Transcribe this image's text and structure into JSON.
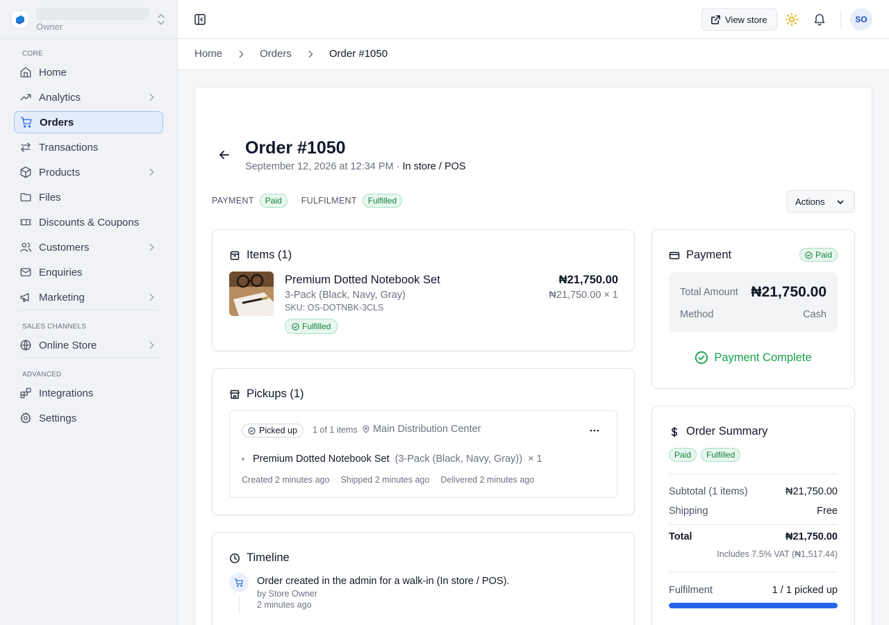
{
  "store": {
    "role": "Owner"
  },
  "nav": {
    "sections": {
      "core": "CORE",
      "sales": "SALES CHANNELS",
      "advanced": "ADVANCED"
    },
    "items": {
      "home": "Home",
      "analytics": "Analytics",
      "orders": "Orders",
      "transactions": "Transactions",
      "products": "Products",
      "files": "Files",
      "discounts": "Discounts & Coupons",
      "customers": "Customers",
      "enquiries": "Enquiries",
      "marketing": "Marketing",
      "online_store": "Online Store",
      "integrations": "Integrations",
      "settings": "Settings"
    },
    "active": "orders"
  },
  "topbar": {
    "view_store": "View store",
    "avatar_initials": "SO"
  },
  "breadcrumb": {
    "home": "Home",
    "orders": "Orders",
    "current": "Order #1050"
  },
  "order": {
    "title": "Order #1050",
    "date": "September 12, 2026 at 12:34 PM",
    "separator": " · ",
    "channel": "In store / POS",
    "payment_label": "PAYMENT",
    "payment_status": "Paid",
    "fulfilment_label": "FULFILMENT",
    "fulfilment_status": "Fulfilled",
    "actions_label": "Actions"
  },
  "items_card": {
    "title": "Items (1)",
    "item": {
      "name": "Premium Dotted Notebook Set",
      "variant": "3-Pack (Black, Navy, Gray)",
      "sku": "SKU: OS-DOTNBK-3CLS",
      "status": "Fulfilled",
      "price": "₦21,750.00",
      "unit_qty": "₦21,750.00 × 1"
    }
  },
  "pickups_card": {
    "title": "Pickups (1)",
    "status": "Picked up",
    "count": "1 of 1 items",
    "location": "Main Distribution Center",
    "line_name": "Premium Dotted Notebook Set",
    "line_variant": "(3-Pack (Black, Navy, Gray))",
    "line_qty": "× 1",
    "created": "Created 2 minutes ago",
    "shipped": "Shipped 2 minutes ago",
    "delivered": "Delivered 2 minutes ago"
  },
  "timeline_card": {
    "title": "Timeline",
    "event_text": "Order created in the admin for a walk-in (In store / POS).",
    "event_by": "by Store Owner",
    "event_time": "2 minutes ago"
  },
  "payment_card": {
    "title": "Payment",
    "status": "Paid",
    "total_label": "Total Amount",
    "total_value": "₦21,750.00",
    "method_label": "Method",
    "method_value": "Cash",
    "complete_label": "Payment Complete"
  },
  "summary_card": {
    "title": "Order Summary",
    "pill_paid": "Paid",
    "pill_fulfilled": "Fulfilled",
    "subtotal_label": "Subtotal (1 items)",
    "subtotal_value": "₦21,750.00",
    "shipping_label": "Shipping",
    "shipping_value": "Free",
    "total_label": "Total",
    "total_value": "₦21,750.00",
    "vat_note": "Includes 7.5% VAT (₦1,517.44)",
    "fulfilment_label": "Fulfilment",
    "fulfilment_value": "1 / 1 picked up",
    "fulfilment_progress": 1.0
  },
  "colors": {
    "accent": "#2563eb",
    "success": "#16a34a",
    "success_bg": "#e7f7ee"
  }
}
